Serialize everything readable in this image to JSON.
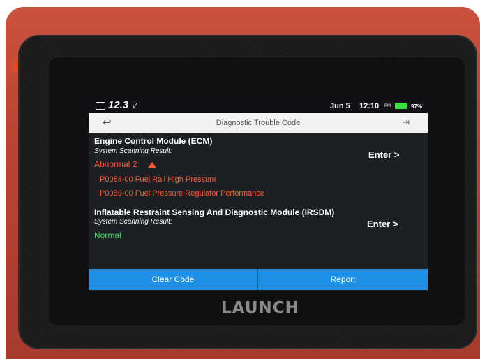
{
  "status_bar": {
    "voltage": "12.3",
    "voltage_unit": "V",
    "date": "Jun 5",
    "time": "12:10",
    "ampm": "PM",
    "battery_percent": "97%"
  },
  "title_bar": {
    "title": "Diagnostic Trouble Code"
  },
  "modules": [
    {
      "name": "Engine Control Module (ECM)",
      "scan_label": "System Scanning Result:",
      "result": "Abnormal 2",
      "codes": [
        "P0088-00 Fuel Rail High Pressure",
        "P0089-00 Fuel Pressure Regulator Performance"
      ],
      "enter_label": "Enter >"
    },
    {
      "name": "Inflatable Restraint Sensing And Diagnostic Module (IRSDM)",
      "scan_label": "System Scanning Result:",
      "result": "Normal",
      "codes": [],
      "enter_label": "Enter >"
    }
  ],
  "actions": {
    "clear_code": "Clear Code",
    "report": "Report"
  },
  "device": {
    "brand": "LAUNCH"
  },
  "colors": {
    "abnormal": "#ff5b30",
    "normal": "#36e05a",
    "button": "#1e90e6",
    "housing": "#b84433"
  }
}
